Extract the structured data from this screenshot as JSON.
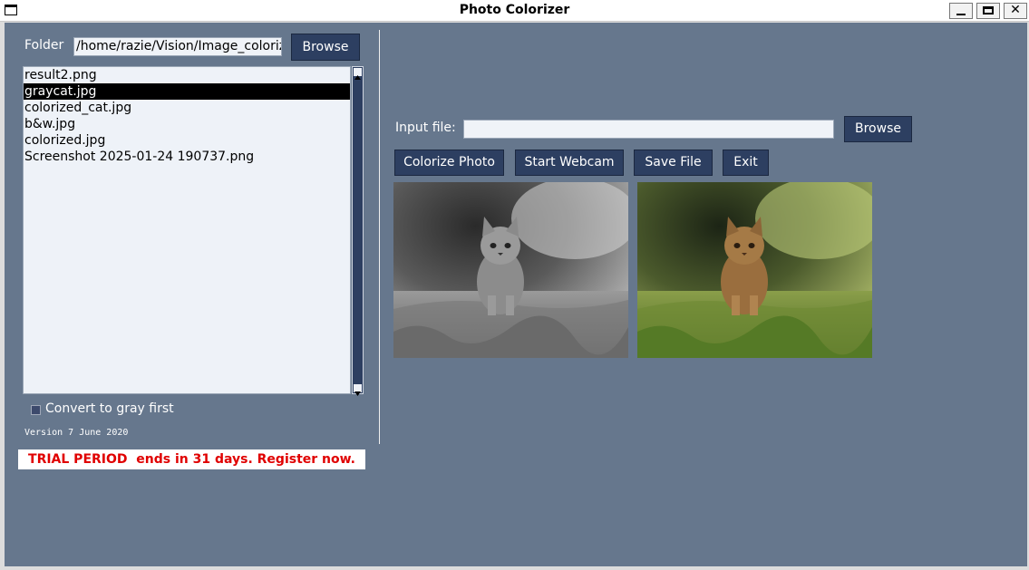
{
  "window": {
    "title": "Photo Colorizer",
    "minimize": "_",
    "close": "✕"
  },
  "left": {
    "folder_label": "Folder",
    "folder_path": "/home/razie/Vision/Image_coloriza",
    "browse_label": "Browse",
    "files": [
      {
        "name": "result2.png",
        "selected": false
      },
      {
        "name": "graycat.jpg",
        "selected": true
      },
      {
        "name": "colorized_cat.jpg",
        "selected": false
      },
      {
        "name": "b&w.jpg",
        "selected": false
      },
      {
        "name": "colorized.jpg",
        "selected": false
      },
      {
        "name": "Screenshot 2025-01-24 190737.png",
        "selected": false
      }
    ],
    "convert_gray_label": "Convert to gray first",
    "convert_gray_checked": false,
    "version": "Version 7 June 2020",
    "trial_notice": "TRIAL PERIOD  ends in 31 days. Register now."
  },
  "right": {
    "input_label": "Input file:",
    "input_value": "",
    "browse_label": "Browse",
    "buttons": {
      "colorize": "Colorize Photo",
      "webcam": "Start Webcam",
      "save": "Save File",
      "exit": "Exit"
    }
  },
  "colors": {
    "background": "#66778d",
    "button": "#2d3f61",
    "trial_text": "#e00000"
  }
}
